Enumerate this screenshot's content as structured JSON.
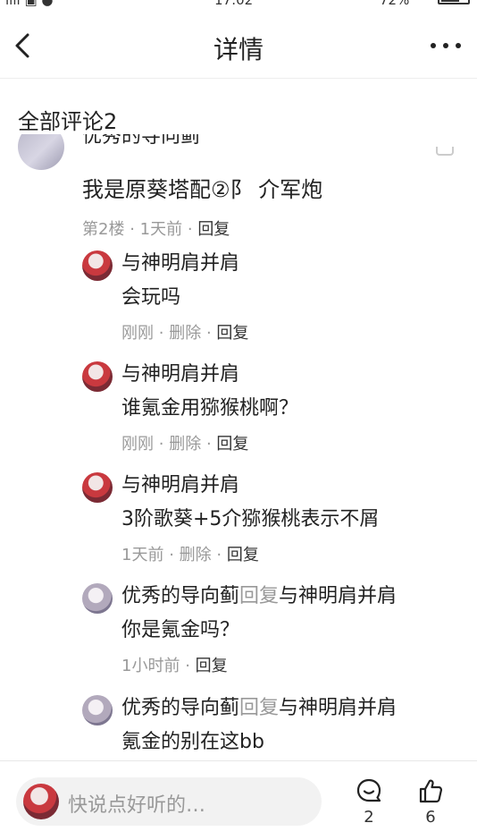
{
  "navbar": {
    "title": "详情"
  },
  "section": {
    "title": "全部评论2"
  },
  "main_comment": {
    "author_clipped": "优秀的导向蓟",
    "text": "我是原葵塔配②阝 介军炮",
    "floor": "第2楼",
    "time": "1天前",
    "reply_label": "回复",
    "separator": "·"
  },
  "replies": [
    {
      "name": "与神明肩并肩",
      "text": "会玩吗",
      "time": "刚刚",
      "delete_label": "删除",
      "reply_label": "回复"
    },
    {
      "name": "与神明肩并肩",
      "text": "谁氪金用猕猴桃啊？",
      "time": "刚刚",
      "delete_label": "删除",
      "reply_label": "回复"
    },
    {
      "name": "与神明肩并肩",
      "text": "3阶歌葵+5介猕猴桃表示不屑",
      "time": "1天前",
      "delete_label": "删除",
      "reply_label": "回复"
    },
    {
      "name": "优秀的导向蓟",
      "reply_word": "回复",
      "target": "与神明肩并肩",
      "text": "你是氪金吗？",
      "time": "1小时前",
      "reply_label": "回复"
    },
    {
      "name": "优秀的导向蓟",
      "reply_word": "回复",
      "target": "与神明肩并肩",
      "text": "氪金的别在这bb"
    }
  ],
  "bottombar": {
    "placeholder": "快说点好听的…",
    "comment_count": "2",
    "like_count": "6",
    "comment_icon": "comment-bubble-icon",
    "like_icon": "thumbs-up-icon"
  },
  "status_bar": {
    "time": "17:02",
    "battery": "72%"
  }
}
